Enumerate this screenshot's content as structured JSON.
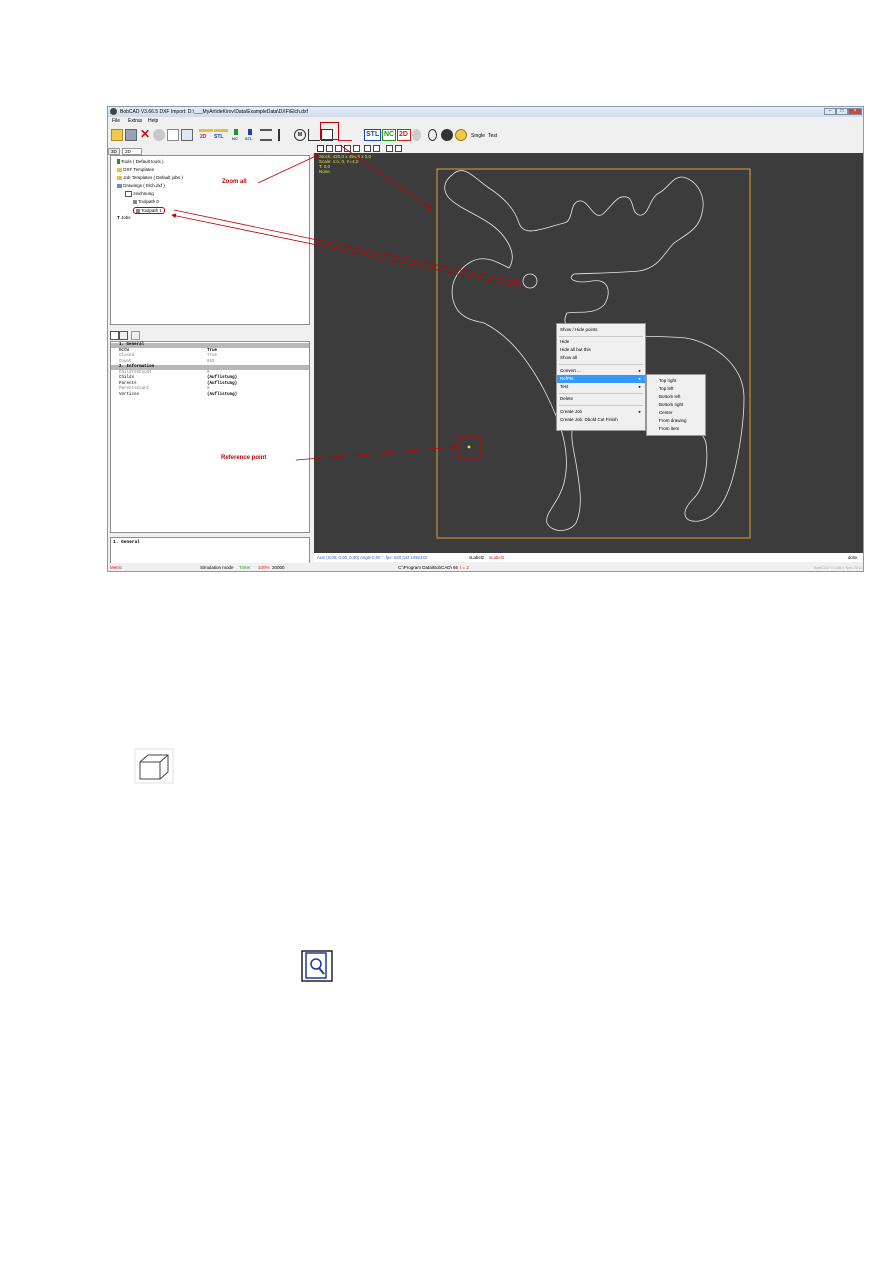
{
  "window": {
    "title": "BobCAD V3.66.5    DXF Import: D:\\___MyArt\\deKirov\\Data\\ExampleData\\DXF\\Elch.dxf"
  },
  "menu": [
    "File",
    "Extras",
    "Help"
  ],
  "toolbar": {
    "btn_2d": "2D",
    "btn_stl": "STL",
    "btn_nc": "NC",
    "btn_stl2": "STL",
    "btn_m": "M",
    "btn_single": "Single",
    "btn_test": "Test",
    "stl_big": "STL",
    "nc_big": "NC",
    "d2_big": "2D"
  },
  "tabs": [
    "3D",
    "2D"
  ],
  "tree": [
    {
      "label": "Tools  ( Default tools )"
    },
    {
      "label": "DXF Templates"
    },
    {
      "label": "Job Templates  ( Default jobs )"
    },
    {
      "label": "Drawings  ( Elch.dxf )"
    },
    {
      "label": "zeichnung"
    },
    {
      "label": "Toolpath 0"
    },
    {
      "label": "Toolpath 1"
    },
    {
      "label": "Jobs"
    }
  ],
  "properties": {
    "rows": [
      {
        "cat": true,
        "key": "1. General",
        "val": ""
      },
      {
        "cat": false,
        "key": "BCCW",
        "val": "True",
        "bold": true
      },
      {
        "cat": false,
        "key": "Closed",
        "val": "True",
        "bold": false
      },
      {
        "cat": false,
        "key": "Count",
        "val": "652",
        "bold": false
      },
      {
        "cat": true,
        "key": "2. Information",
        "val": ""
      },
      {
        "cat": false,
        "key": "ChildrenCount",
        "val": "0",
        "bold": false
      },
      {
        "cat": false,
        "key": "Childs",
        "val": "(Auflistung)",
        "bold": true
      },
      {
        "cat": false,
        "key": "Parents",
        "val": "(Auflistung)",
        "bold": true
      },
      {
        "cat": false,
        "key": "ParentsCount",
        "val": "0",
        "bold": false
      },
      {
        "cat": false,
        "key": "Vertices",
        "val": "(Auflistung)",
        "bold": true
      }
    ],
    "description": "1. General"
  },
  "overlay": {
    "line1": "Stock: 420,0 x 494,6 x 0,0",
    "line2": "Scale: 1:n, 0, Y=4,0",
    "line3": "T: 0,0",
    "line4": "None"
  },
  "context_menu": {
    "items": [
      "Show / Hide points",
      "Hide",
      "Hide all but this",
      "Show all",
      "Convert ...",
      "RefPkt",
      "Test",
      "Delete",
      "Create Job",
      "Create Job: Dbold Cut Finish"
    ],
    "highlighted": "RefPkt"
  },
  "submenu": {
    "items": [
      "Top right",
      "Top left",
      "Bottom left",
      "Bottom right",
      "Center",
      "From drawing",
      "From item"
    ]
  },
  "annotations": {
    "zoom_all": "Zoom all",
    "reference_point": "Reference point"
  },
  "coord_bar": {
    "text": "Axis (0,00, 0,00, 0,00) Angle 0,00 °, fps: 620,042   199x342",
    "label_a": "sLabel2",
    "label_b": "sLabel3",
    "right": "done"
  },
  "status_bar": {
    "left": "Metric",
    "sim_label": "Simulation mode",
    "sim_val": "Timer",
    "speed": "100%",
    "speed2": "20000",
    "path": "C:\\Program Data\\BobCAD\\ 66",
    "tz": "t = 2",
    "right": "BobCAD V3.66.5 Nov 2014"
  },
  "colors": {
    "canvas": "#3c3c3c",
    "stock_border": "#e0a030",
    "contour": "#e8e8e8",
    "annotation": "#c00000",
    "overlay_text": "#e6e62e"
  }
}
